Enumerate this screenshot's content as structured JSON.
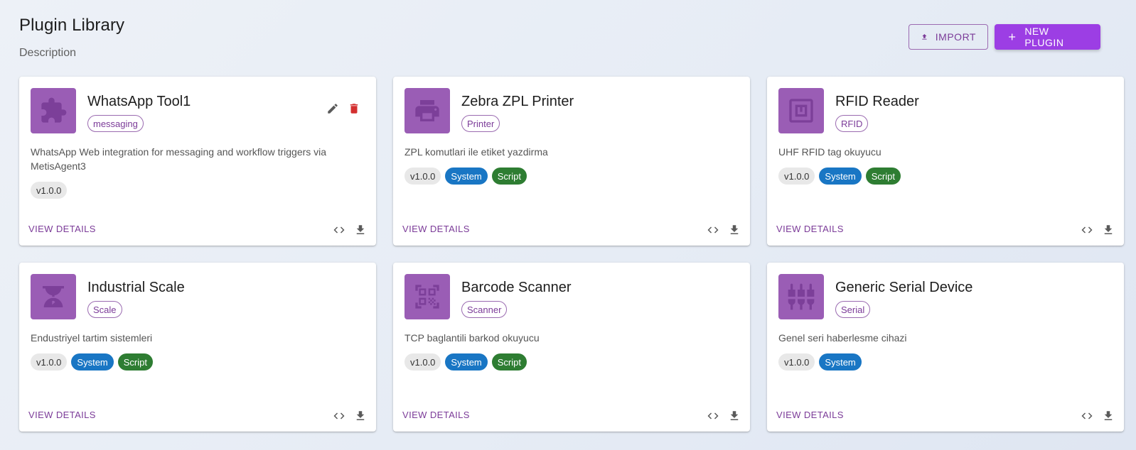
{
  "page": {
    "title": "Plugin Library",
    "description": "Description"
  },
  "actions": {
    "import_label": "Import",
    "new_plugin_label": "New Plugin"
  },
  "common": {
    "view_details_label": "View Details"
  },
  "colors": {
    "accent": "#7b3b98",
    "primary_button": "#9c3ee4",
    "icon_tile": "#9a5db5",
    "system_chip": "#1976c4",
    "script_chip": "#2e7d32",
    "delete": "#d32f2f"
  },
  "plugins": [
    {
      "name": "WhatsApp Tool1",
      "category": "messaging",
      "icon": "puzzle-icon",
      "description": "WhatsApp Web integration for messaging and workflow triggers via MetisAgent3",
      "version": "v1.0.0",
      "tags": []
    },
    {
      "name": "Zebra ZPL Printer",
      "category": "Printer",
      "icon": "printer-icon",
      "description": "ZPL komutlari ile etiket yazdirma",
      "version": "v1.0.0",
      "tags": [
        "System",
        "Script"
      ]
    },
    {
      "name": "RFID Reader",
      "category": "RFID",
      "icon": "rfid-icon",
      "description": "UHF RFID tag okuyucu",
      "version": "v1.0.0",
      "tags": [
        "System",
        "Script"
      ]
    },
    {
      "name": "Industrial Scale",
      "category": "Scale",
      "icon": "scale-icon",
      "description": "Endustriyel tartim sistemleri",
      "version": "v1.0.0",
      "tags": [
        "System",
        "Script"
      ]
    },
    {
      "name": "Barcode Scanner",
      "category": "Scanner",
      "icon": "qr-code-scanner-icon",
      "description": "TCP baglantili barkod okuyucu",
      "version": "v1.0.0",
      "tags": [
        "System",
        "Script"
      ]
    },
    {
      "name": "Generic Serial Device",
      "category": "Serial",
      "icon": "settings-input-component-icon",
      "description": "Genel seri haberlesme cihazi",
      "version": "v1.0.0",
      "tags": [
        "System"
      ]
    }
  ]
}
